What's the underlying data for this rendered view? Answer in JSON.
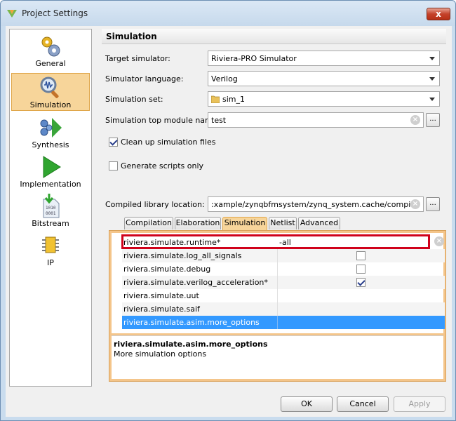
{
  "window": {
    "title": "Project Settings",
    "close": "x"
  },
  "sidebar": {
    "items": [
      {
        "label": "General"
      },
      {
        "label": "Simulation"
      },
      {
        "label": "Synthesis"
      },
      {
        "label": "Implementation"
      },
      {
        "label": "Bitstream"
      },
      {
        "label": "IP"
      }
    ]
  },
  "panel": {
    "title": "Simulation",
    "target_simulator": {
      "label": "Target simulator:",
      "value": "Riviera-PRO Simulator"
    },
    "simulator_language": {
      "label": "Simulator language:",
      "value": "Verilog"
    },
    "simulation_set": {
      "label": "Simulation set:",
      "value": "sim_1"
    },
    "top_module": {
      "label": "Simulation top module name:",
      "value": "test",
      "browse": "..."
    },
    "clean_up": {
      "label": "Clean up simulation files",
      "checked": true
    },
    "generate_scripts": {
      "label": "Generate scripts only",
      "checked": false
    },
    "compiled_lib": {
      "label": "Compiled library location:",
      "value": ":xample/zynqbfmsystem/zynq_system.cache/compile_simlib",
      "browse": "..."
    }
  },
  "tabs": [
    {
      "label": "Compilation"
    },
    {
      "label": "Elaboration"
    },
    {
      "label": "Simulation"
    },
    {
      "label": "Netlist"
    },
    {
      "label": "Advanced"
    }
  ],
  "options": [
    {
      "key": "riviera.simulate.runtime*",
      "value": "-all"
    },
    {
      "key": "riviera.simulate.log_all_signals",
      "checked": false
    },
    {
      "key": "riviera.simulate.debug",
      "checked": false
    },
    {
      "key": "riviera.simulate.verilog_acceleration*",
      "checked": true
    },
    {
      "key": "riviera.simulate.uut",
      "value": ""
    },
    {
      "key": "riviera.simulate.saif",
      "value": ""
    },
    {
      "key": "riviera.simulate.asim.more_options",
      "value": ""
    }
  ],
  "description": {
    "title": "riviera.simulate.asim.more_options",
    "text": "More simulation options"
  },
  "buttons": {
    "ok": "OK",
    "cancel": "Cancel",
    "apply": "Apply"
  },
  "colors": {
    "selection": "#3399ff",
    "highlight_box": "#d0021b",
    "nav_selected": "#f7d59a"
  }
}
